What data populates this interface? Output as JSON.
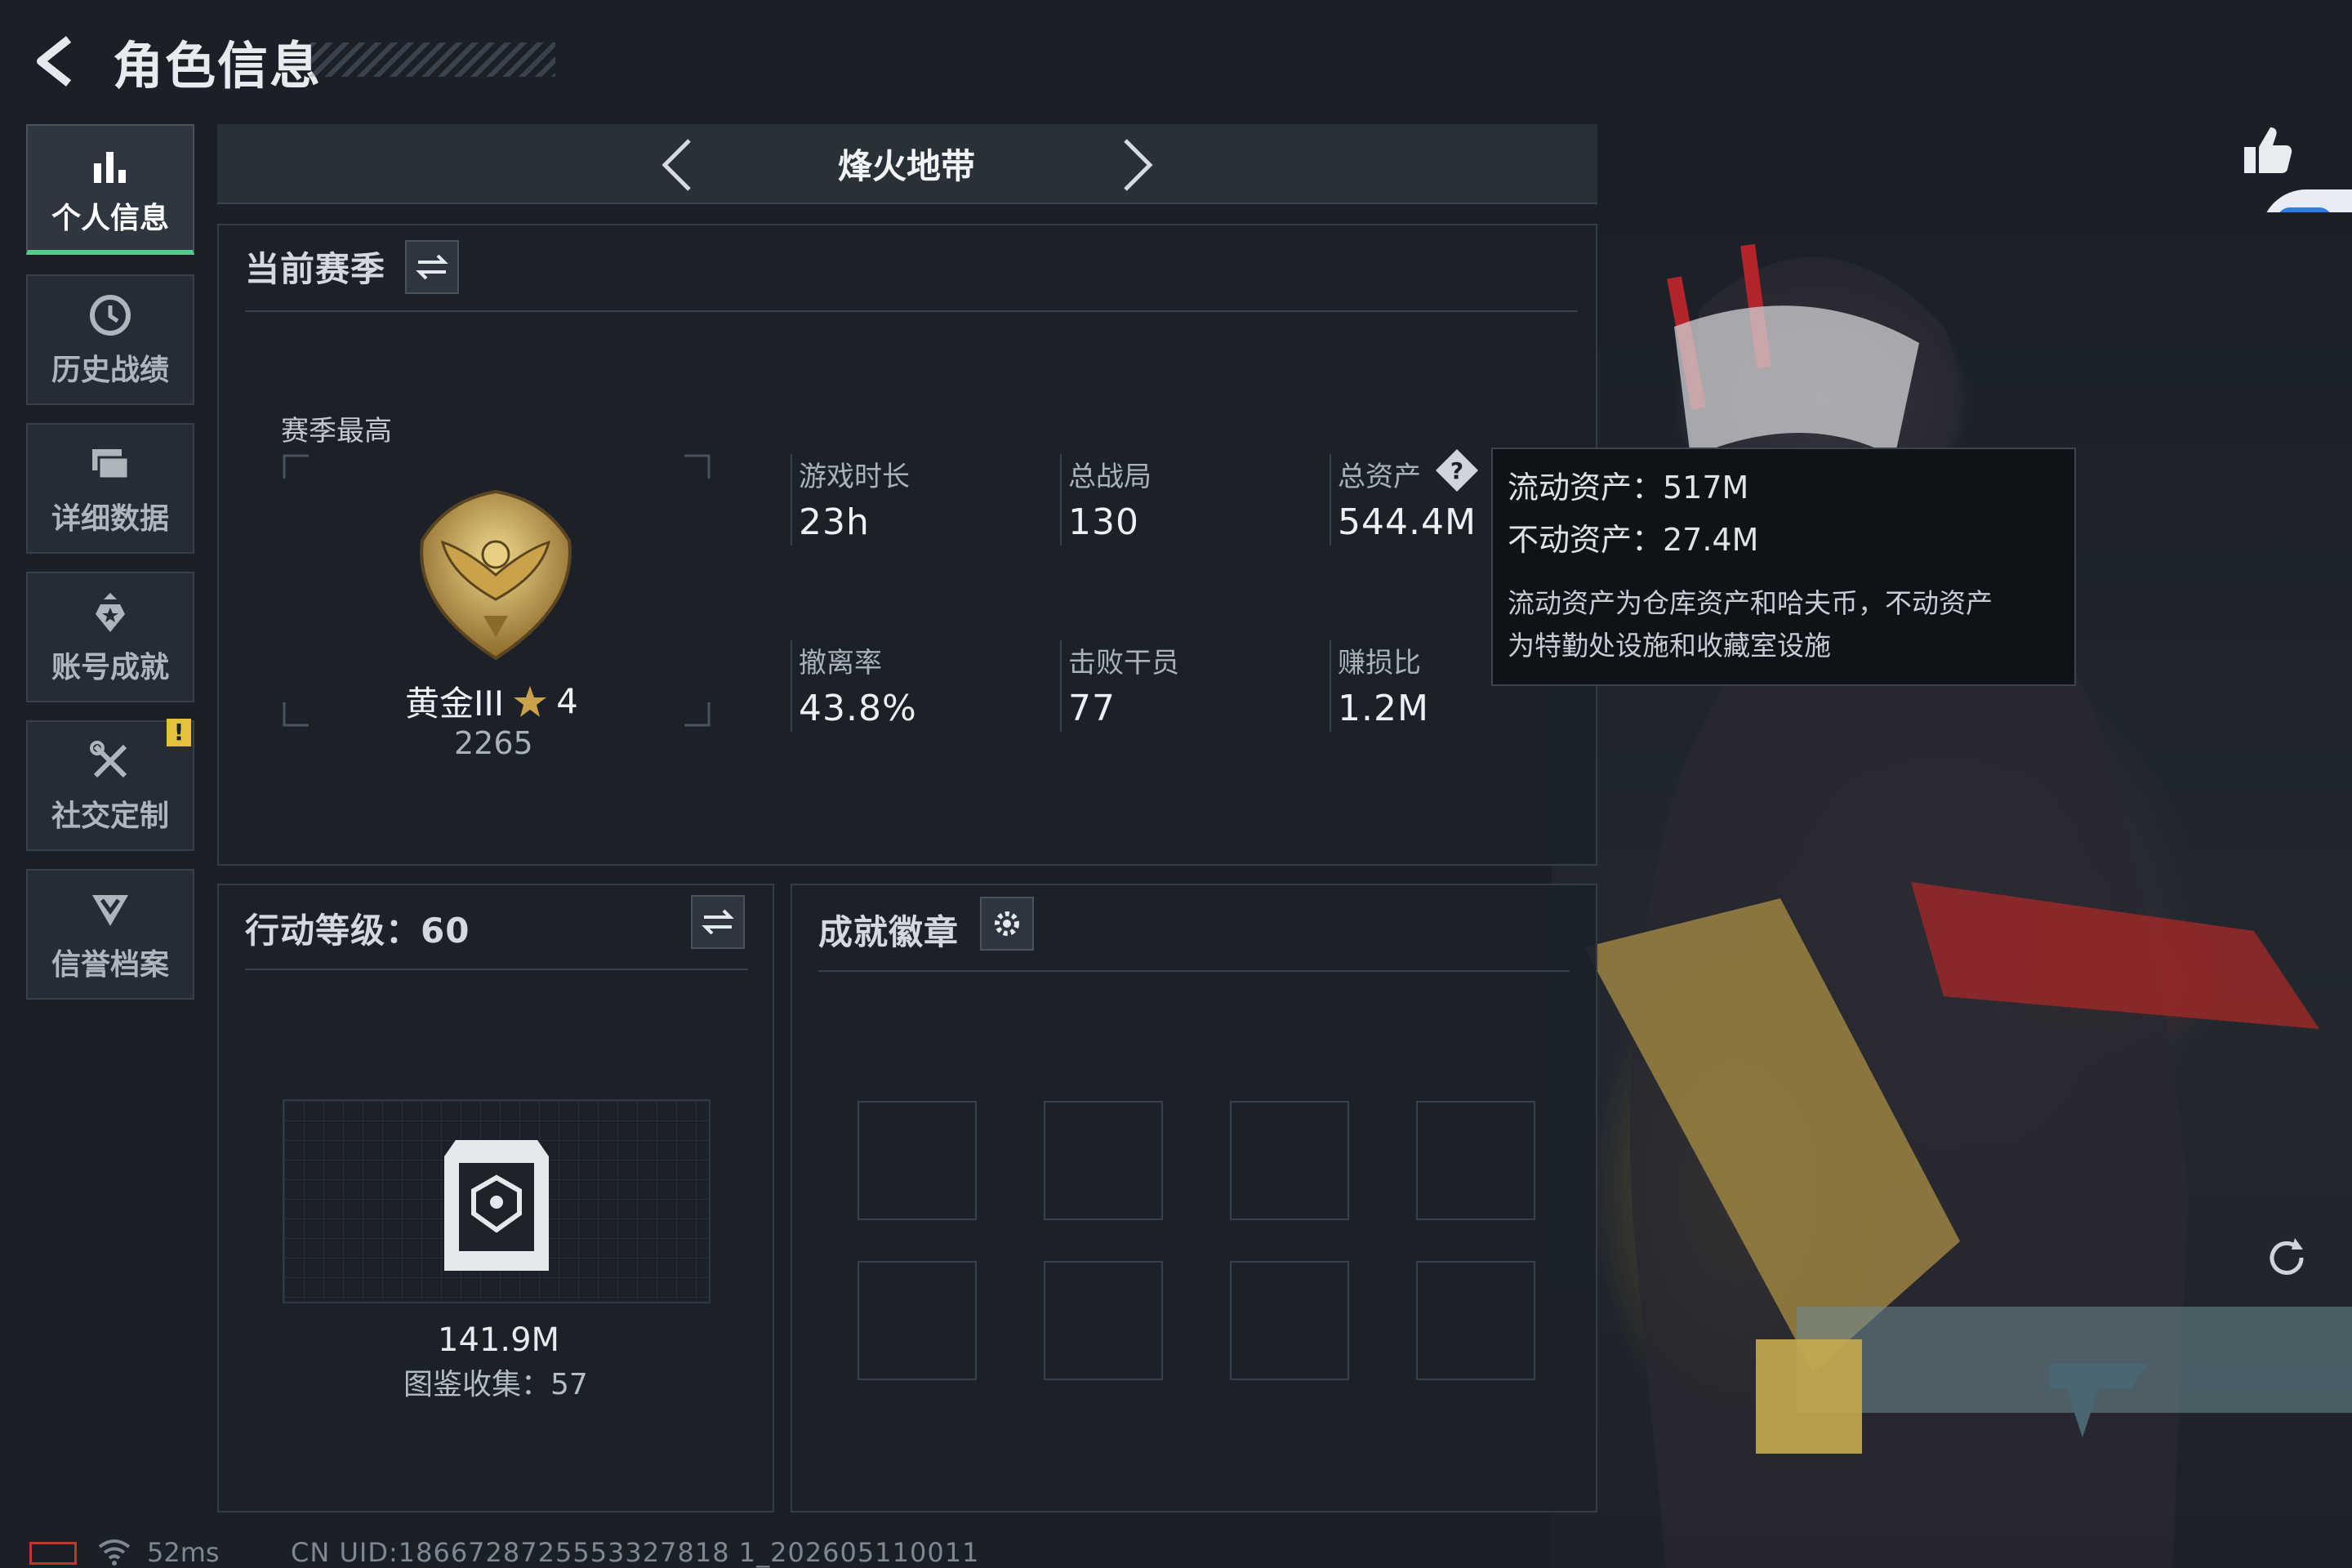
{
  "header": {
    "title": "角色信息"
  },
  "sidebar": {
    "items": [
      {
        "label": "个人信息",
        "icon": "bar-chart-icon",
        "active": true
      },
      {
        "label": "历史战绩",
        "icon": "history-clock-icon",
        "active": false
      },
      {
        "label": "详细数据",
        "icon": "folder-stack-icon",
        "active": false
      },
      {
        "label": "账号成就",
        "icon": "achievement-star-icon",
        "active": false
      },
      {
        "label": "社交定制",
        "icon": "tools-icon",
        "active": false,
        "alert": "!"
      },
      {
        "label": "信誉档案",
        "icon": "shield-chevron-icon",
        "active": false
      }
    ]
  },
  "mode": {
    "title": "烽火地带"
  },
  "season_panel": {
    "title": "当前赛季",
    "best_label": "赛季最高",
    "rank_name": "黄金III",
    "rank_stars": "4",
    "rank_score": "2265",
    "stats": [
      {
        "label": "游戏时长",
        "value": "23h"
      },
      {
        "label": "总战局",
        "value": "130"
      },
      {
        "label": "总资产",
        "value": "544.4M"
      },
      {
        "label": "撤离率",
        "value": "43.8%"
      },
      {
        "label": "击败干员",
        "value": "77"
      },
      {
        "label": "赚损比",
        "value": "1.2M"
      }
    ]
  },
  "tooltip": {
    "liquid": "流动资产：517M",
    "fixed": "不动资产：27.4M",
    "note_line1": "流动资产为仓库资产和哈夫币，不动资产",
    "note_line2": "为特勤处设施和收藏室设施"
  },
  "action_panel": {
    "title": "行动等级：60",
    "collection_value": "141.9M",
    "collection_count": "图鉴收集：57"
  },
  "badge_panel": {
    "title": "成就徽章",
    "slots": 8
  },
  "footer": {
    "ping": "52ms",
    "uid": "CN UID:1866728725553327818 1_202605110011"
  },
  "colors": {
    "accent_green": "#4fd08a",
    "alert_yellow": "#e4c33c",
    "gold": "#c9a24a",
    "access_blue": "#2f7de1"
  }
}
